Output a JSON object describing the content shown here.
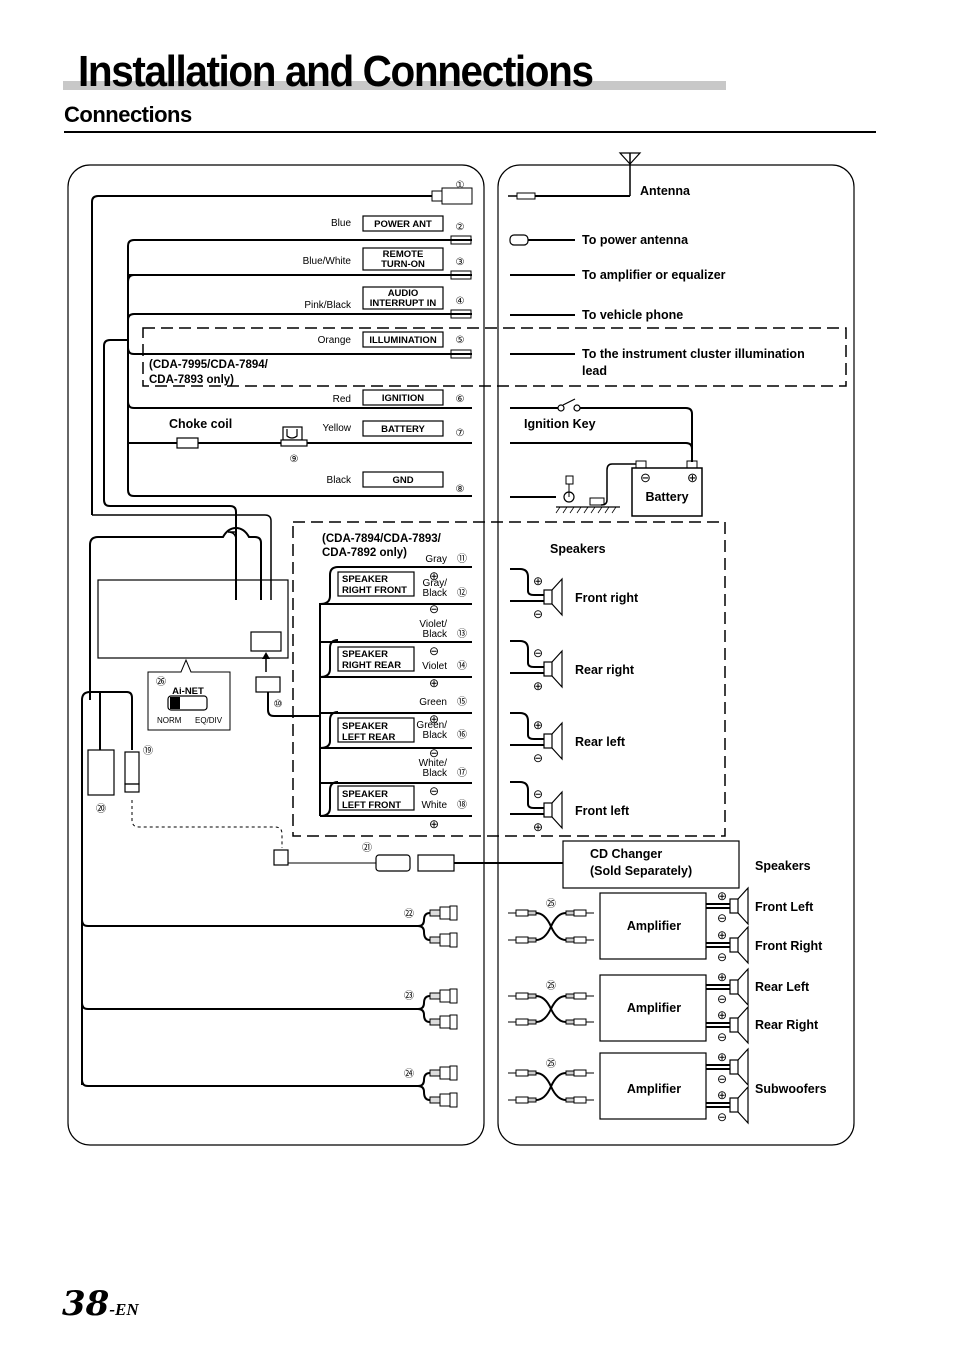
{
  "page": {
    "title": "Installation and Connections",
    "section": "Connections",
    "page_number": "38",
    "page_suffix": "-EN"
  },
  "head_unit_leads": [
    {
      "num": "①",
      "wire": "",
      "function": ""
    },
    {
      "num": "②",
      "wire": "Blue",
      "function": "POWER ANT"
    },
    {
      "num": "③",
      "wire": "Blue/White",
      "function_lines": [
        "REMOTE",
        "TURN-ON"
      ]
    },
    {
      "num": "④",
      "wire": "Pink/Black",
      "function_lines": [
        "AUDIO",
        "INTERRUPT IN"
      ]
    },
    {
      "num": "⑤",
      "wire": "Orange",
      "function": "ILLUMINATION"
    },
    {
      "num": "⑥",
      "wire": "Red",
      "function": "IGNITION"
    },
    {
      "num": "⑦",
      "wire": "Yellow",
      "function": "BATTERY"
    },
    {
      "num": "⑧",
      "wire": "Black",
      "function": "GND"
    },
    {
      "num": "⑨"
    },
    {
      "num": "⑩"
    }
  ],
  "notes": {
    "illumination_models": [
      "(CDA-7995/CDA-7894/",
      "CDA-7893 only)"
    ],
    "speaker_models": [
      "(CDA-7894/CDA-7893/",
      "CDA-7892 only)"
    ],
    "choke_coil": "Choke coil"
  },
  "destinations": {
    "antenna": "Antenna",
    "power_antenna": "To power antenna",
    "amplifier": "To amplifier or equalizer",
    "phone": "To vehicle phone",
    "illumination_lines": [
      "To the instrument cluster illumination",
      "lead"
    ],
    "ignition_key": "Ignition Key",
    "battery": "Battery"
  },
  "speaker_leads": {
    "header": "Speakers",
    "groups": [
      {
        "box": [
          "SPEAKER",
          "RIGHT FRONT"
        ],
        "speaker": "Front right"
      },
      {
        "box": [
          "SPEAKER",
          "RIGHT REAR"
        ],
        "speaker": "Rear right"
      },
      {
        "box": [
          "SPEAKER",
          "LEFT REAR"
        ],
        "speaker": "Rear left"
      },
      {
        "box": [
          "SPEAKER",
          "LEFT FRONT"
        ],
        "speaker": "Front left"
      }
    ],
    "wires": [
      {
        "num": "⑪",
        "color": [
          "Gray"
        ]
      },
      {
        "num": "⑫",
        "color": [
          "Gray/",
          "Black"
        ]
      },
      {
        "num": "⑬",
        "color": [
          "Violet/",
          "Black"
        ]
      },
      {
        "num": "⑭",
        "color": [
          "Violet"
        ]
      },
      {
        "num": "⑮",
        "color": [
          "Green"
        ]
      },
      {
        "num": "⑯",
        "color": [
          "Green/",
          "Black"
        ]
      },
      {
        "num": "⑰",
        "color": [
          "White/",
          "Black"
        ]
      },
      {
        "num": "⑱",
        "color": [
          "White"
        ]
      }
    ]
  },
  "ai_net": {
    "num": "㉖",
    "label": "Ai-NET",
    "left": "NORM",
    "right": "EQ/DIV"
  },
  "misc_numbers": {
    "n19": "⑲",
    "n20": "⑳",
    "n21": "㉑",
    "n22": "㉒",
    "n23": "㉓",
    "n24": "㉔",
    "n25": "㉕"
  },
  "cd_changer": [
    "CD Changer",
    "(Sold Separately)"
  ],
  "amplifiers": {
    "label": "Amplifier",
    "speakers_header": "Speakers",
    "outputs": [
      "Front Left",
      "Front Right",
      "Rear Left",
      "Rear Right",
      "Subwoofers"
    ]
  },
  "symbols": {
    "plus": "⊕",
    "minus": "⊖"
  }
}
